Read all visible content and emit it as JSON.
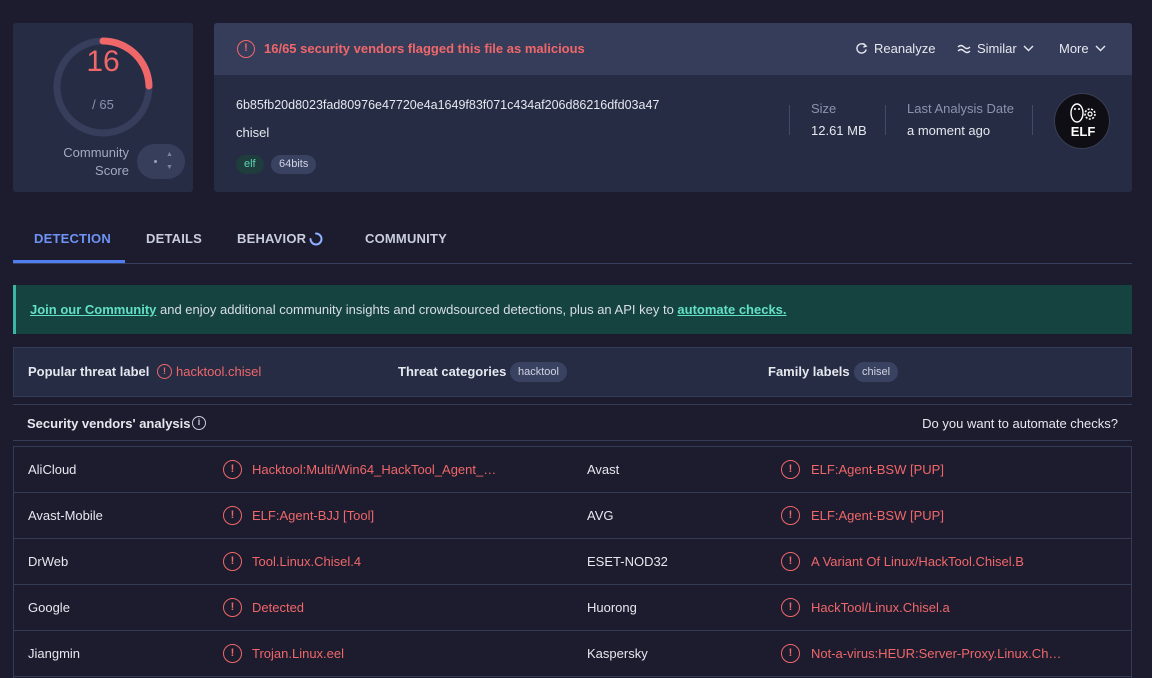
{
  "score": {
    "detections": "16",
    "total": "/ 65",
    "community_label_1": "Community",
    "community_label_2": "Score",
    "detections_fraction": 0.246
  },
  "header": {
    "alert": "16/65 security vendors flagged this file as malicious",
    "reanalyze": "Reanalyze",
    "similar": "Similar",
    "more": "More"
  },
  "file": {
    "hash": "6b85fb20d8023fad80976e47720e4a1649f83f071c434af206d86216dfd03a47",
    "name": "chisel",
    "tags": [
      "elf",
      "64bits"
    ],
    "size_label": "Size",
    "size": "12.61 MB",
    "last_analysis_label": "Last Analysis Date",
    "last_analysis": "a moment ago",
    "type_badge": "ELF"
  },
  "tabs": [
    "DETECTION",
    "DETAILS",
    "BEHAVIOR",
    "COMMUNITY"
  ],
  "banner": {
    "link1": "Join our Community",
    "text": " and enjoy additional community insights and crowdsourced detections, plus an API key to ",
    "link2": "automate checks."
  },
  "threat": {
    "popular_label": "Popular threat label",
    "popular_value": "hacktool.chisel",
    "categories_label": "Threat categories",
    "categories_value": "hacktool",
    "family_label": "Family labels",
    "family_value": "chisel"
  },
  "analysis": {
    "title": "Security vendors' analysis",
    "automate": "Do you want to automate checks?"
  },
  "vendors": [
    {
      "left_name": "AliCloud",
      "left_result": "Hacktool:Multi/Win64_HackTool_Agent_…",
      "right_name": "Avast",
      "right_result": "ELF:Agent-BSW [PUP]"
    },
    {
      "left_name": "Avast-Mobile",
      "left_result": "ELF:Agent-BJJ [Tool]",
      "right_name": "AVG",
      "right_result": "ELF:Agent-BSW [PUP]"
    },
    {
      "left_name": "DrWeb",
      "left_result": "Tool.Linux.Chisel.4",
      "right_name": "ESET-NOD32",
      "right_result": "A Variant Of Linux/HackTool.Chisel.B"
    },
    {
      "left_name": "Google",
      "left_result": "Detected",
      "right_name": "Huorong",
      "right_result": "HackTool/Linux.Chisel.a"
    },
    {
      "left_name": "Jiangmin",
      "left_result": "Trojan.Linux.eel",
      "right_name": "Kaspersky",
      "right_result": "Not-a-virus:HEUR:Server-Proxy.Linux.Ch…"
    }
  ],
  "colors": {
    "danger": "#f0676a",
    "accent": "#4f7ef0",
    "background": "#1c1c2e",
    "card": "#262c44"
  }
}
